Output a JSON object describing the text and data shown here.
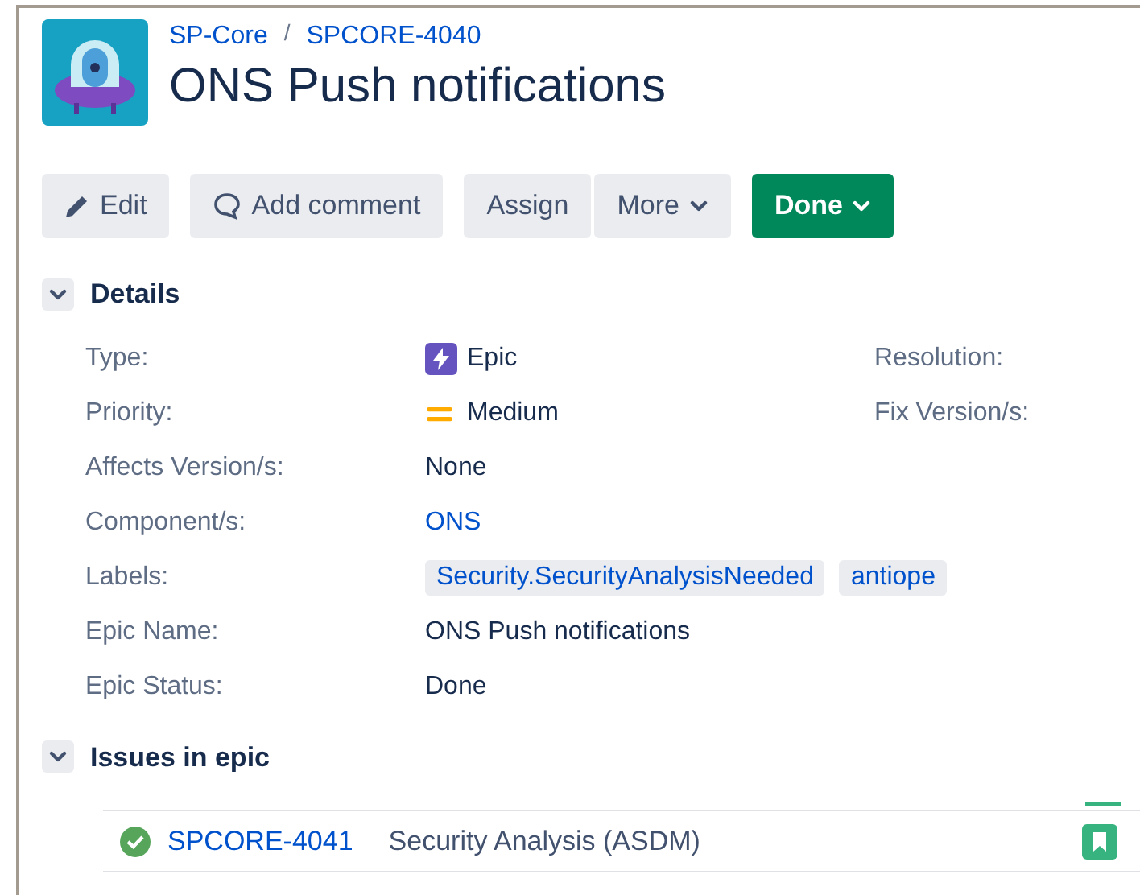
{
  "breadcrumb": {
    "project": "SP-Core",
    "separator": "/",
    "issue_key": "SPCORE-4040"
  },
  "title": "ONS Push notifications",
  "toolbar": [
    {
      "kind": "edit",
      "label": "Edit"
    },
    {
      "kind": "comment",
      "label": "Add comment"
    },
    {
      "kind": "joined",
      "label": "Assign"
    },
    {
      "kind": "joined_dropdown",
      "label": "More"
    },
    {
      "kind": "status",
      "label": "Done"
    }
  ],
  "details": {
    "heading": "Details",
    "expanded": true,
    "fields": [
      {
        "label": "Type:",
        "kind": "epic",
        "value": "Epic"
      },
      {
        "label": "Priority:",
        "kind": "priority",
        "value": "Medium"
      },
      {
        "label": "Affects Version/s:",
        "kind": "text",
        "value": "None"
      },
      {
        "label": "Component/s:",
        "kind": "link",
        "value": "ONS"
      },
      {
        "label": "Labels:",
        "kind": "labels",
        "values": [
          "Security.SecurityAnalysisNeeded",
          "antiope"
        ]
      },
      {
        "label": "Epic Name:",
        "kind": "text",
        "value": "ONS Push notifications"
      },
      {
        "label": "Epic Status:",
        "kind": "text",
        "value": "Done"
      }
    ],
    "side_fields": [
      {
        "label": "Resolution:"
      },
      {
        "label": "Fix Version/s:"
      }
    ]
  },
  "issues": {
    "heading": "Issues in epic",
    "expanded": true,
    "rows": [
      {
        "done": true,
        "key": "SPCORE-4041",
        "summary": "Security Analysis (ASDM)",
        "kind": "story"
      }
    ]
  }
}
